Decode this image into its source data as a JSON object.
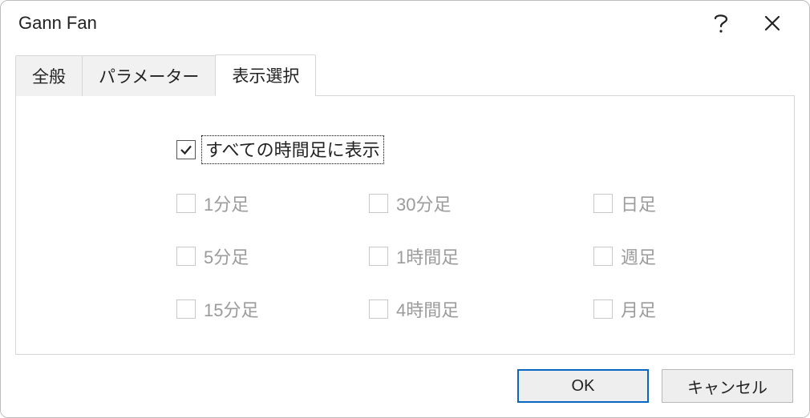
{
  "title": "Gann Fan",
  "tabs": {
    "general": "全般",
    "parameters": "パラメーター",
    "display": "表示選択"
  },
  "activeTab": "display",
  "checkboxes": {
    "all": {
      "label": "すべての時間足に表示",
      "checked": true,
      "disabled": false
    },
    "m1": {
      "label": "1分足",
      "checked": false,
      "disabled": true
    },
    "m5": {
      "label": "5分足",
      "checked": false,
      "disabled": true
    },
    "m15": {
      "label": "15分足",
      "checked": false,
      "disabled": true
    },
    "m30": {
      "label": "30分足",
      "checked": false,
      "disabled": true
    },
    "h1": {
      "label": "1時間足",
      "checked": false,
      "disabled": true
    },
    "h4": {
      "label": "4時間足",
      "checked": false,
      "disabled": true
    },
    "d1": {
      "label": "日足",
      "checked": false,
      "disabled": true
    },
    "w1": {
      "label": "週足",
      "checked": false,
      "disabled": true
    },
    "mn": {
      "label": "月足",
      "checked": false,
      "disabled": true
    }
  },
  "buttons": {
    "ok": "OK",
    "cancel": "キャンセル"
  }
}
